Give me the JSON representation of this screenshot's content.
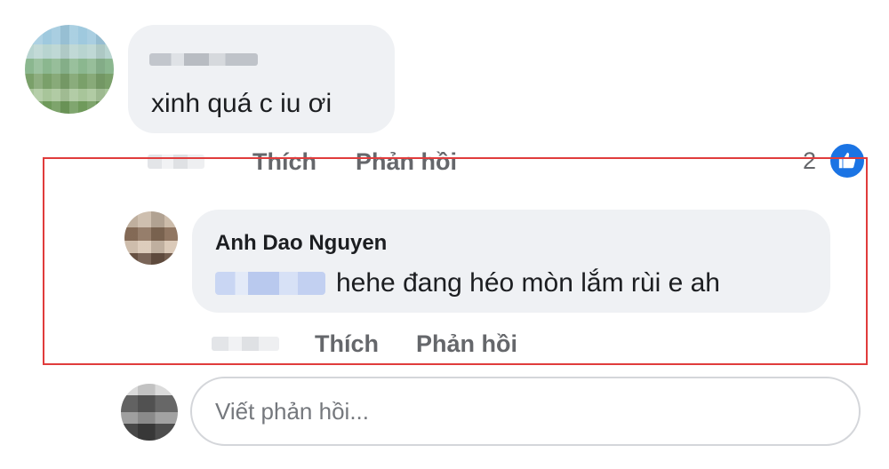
{
  "comment": {
    "text": "xinh quá c iu ơi",
    "actions": {
      "like_label": "Thích",
      "reply_label": "Phản hồi"
    },
    "like_count": "2"
  },
  "reply": {
    "author": "Anh Dao Nguyen",
    "text": "hehe đang héo mòn lắm rùi e ah",
    "actions": {
      "like_label": "Thích",
      "reply_label": "Phản hồi"
    }
  },
  "compose": {
    "placeholder": "Viết phản hồi..."
  },
  "colors": {
    "highlight_border": "#e03c3c",
    "like_icon_bg": "#1b74e4"
  },
  "icons": {
    "like_reaction": "thumbs-up-icon"
  }
}
